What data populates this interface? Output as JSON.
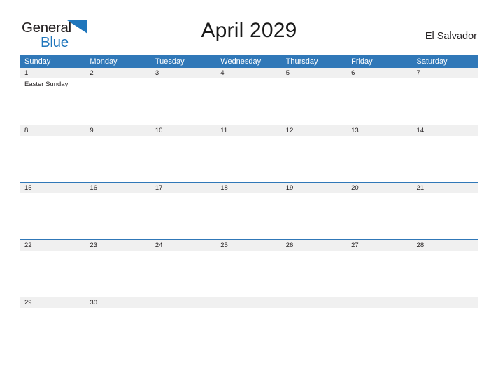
{
  "brand": {
    "name_part1": "General",
    "name_part2": "Blue",
    "accent_color": "#1f76bc"
  },
  "header": {
    "title": "April 2029",
    "locale": "El Salvador"
  },
  "calendar": {
    "header_color": "#3078b8",
    "band_color": "#f0f0f0",
    "day_names": [
      "Sunday",
      "Monday",
      "Tuesday",
      "Wednesday",
      "Thursday",
      "Friday",
      "Saturday"
    ],
    "weeks": [
      [
        {
          "date": "1",
          "events": [
            "Easter Sunday"
          ]
        },
        {
          "date": "2",
          "events": []
        },
        {
          "date": "3",
          "events": []
        },
        {
          "date": "4",
          "events": []
        },
        {
          "date": "5",
          "events": []
        },
        {
          "date": "6",
          "events": []
        },
        {
          "date": "7",
          "events": []
        }
      ],
      [
        {
          "date": "8",
          "events": []
        },
        {
          "date": "9",
          "events": []
        },
        {
          "date": "10",
          "events": []
        },
        {
          "date": "11",
          "events": []
        },
        {
          "date": "12",
          "events": []
        },
        {
          "date": "13",
          "events": []
        },
        {
          "date": "14",
          "events": []
        }
      ],
      [
        {
          "date": "15",
          "events": []
        },
        {
          "date": "16",
          "events": []
        },
        {
          "date": "17",
          "events": []
        },
        {
          "date": "18",
          "events": []
        },
        {
          "date": "19",
          "events": []
        },
        {
          "date": "20",
          "events": []
        },
        {
          "date": "21",
          "events": []
        }
      ],
      [
        {
          "date": "22",
          "events": []
        },
        {
          "date": "23",
          "events": []
        },
        {
          "date": "24",
          "events": []
        },
        {
          "date": "25",
          "events": []
        },
        {
          "date": "26",
          "events": []
        },
        {
          "date": "27",
          "events": []
        },
        {
          "date": "28",
          "events": []
        }
      ],
      [
        {
          "date": "29",
          "events": []
        },
        {
          "date": "30",
          "events": []
        },
        {
          "date": "",
          "events": []
        },
        {
          "date": "",
          "events": []
        },
        {
          "date": "",
          "events": []
        },
        {
          "date": "",
          "events": []
        },
        {
          "date": "",
          "events": []
        }
      ]
    ]
  }
}
